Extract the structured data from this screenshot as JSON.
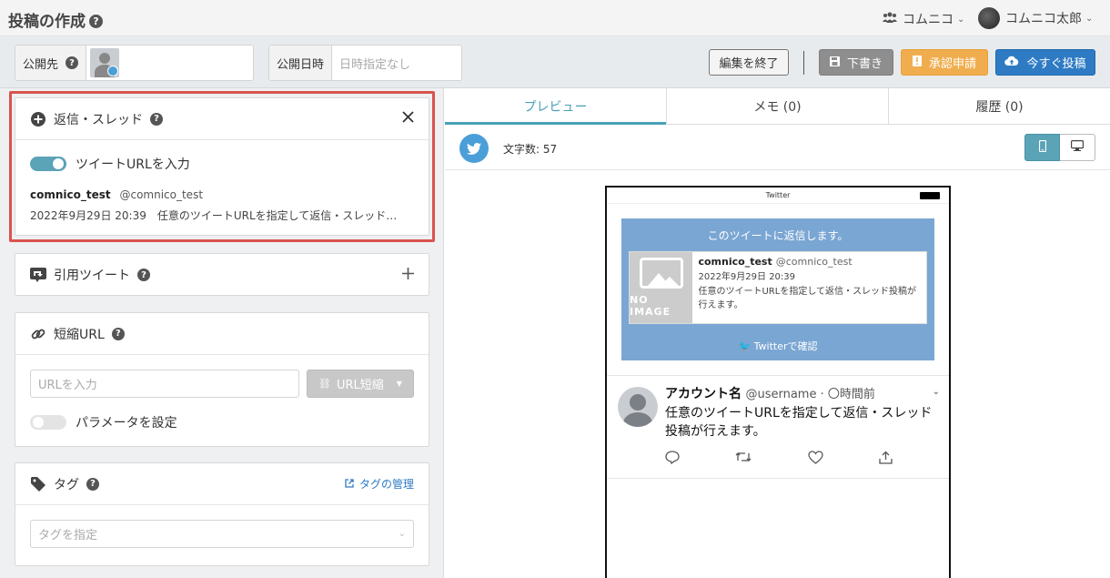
{
  "header": {
    "title": "投稿の作成",
    "help": "?",
    "team_name": "コムニコ",
    "user_name": "コムニコ太郎"
  },
  "toolbar": {
    "destination_label": "公開先",
    "destination_help": "?",
    "datetime_label": "公開日時",
    "datetime_placeholder": "日時指定なし",
    "finish_edit_label": "編集を終了",
    "draft_label": "下書き",
    "approval_label": "承認申請",
    "post_now_label": "今すぐ投稿"
  },
  "reply_card": {
    "title": "返信・スレッド",
    "help": "?",
    "toggle_label": "ツイートURLを入力",
    "toggle_on": true,
    "account_name": "comnico_test",
    "account_handle": "@comnico_test",
    "tweet_summary": "2022年9月29日 20:39　任意のツイートURLを指定して返信・スレッド…"
  },
  "quote_card": {
    "title": "引用ツイート",
    "help": "?"
  },
  "short_url_card": {
    "title": "短縮URL",
    "help": "?",
    "url_placeholder": "URLを入力",
    "shorten_button": "URL短縮",
    "param_toggle_label": "パラメータを設定",
    "param_toggle_on": false
  },
  "tag_card": {
    "title": "タグ",
    "help": "?",
    "manage_link": "タグの管理",
    "tag_placeholder": "タグを指定"
  },
  "tabs": [
    {
      "label": "プレビュー",
      "active": true
    },
    {
      "label": "メモ (0)",
      "active": false
    },
    {
      "label": "履歴 (0)",
      "active": false
    }
  ],
  "preview": {
    "char_count": "文字数: 57",
    "status_title": "Twitter",
    "reply_banner": "このツイートに返信します。",
    "quoted_name": "comnico_test",
    "quoted_handle": "@comnico_test",
    "quoted_date": "2022年9月29日 20:39",
    "quoted_text": "任意のツイートURLを指定して返信・スレッド投稿が行えます。",
    "no_image": "NO IMAGE",
    "confirm_link": "Twitterで確認",
    "tweet_name": "アカウント名",
    "tweet_meta": "@username · 〇時間前",
    "tweet_text": "任意のツイートURLを指定して返信・スレッド投稿が行えます。"
  },
  "colors": {
    "accent": "#5ba3b7",
    "highlight": "#d9534f",
    "twitter_blue": "#4a9fd8",
    "primary_button": "#2e7bc4",
    "warning_button": "#f0ad4e"
  }
}
